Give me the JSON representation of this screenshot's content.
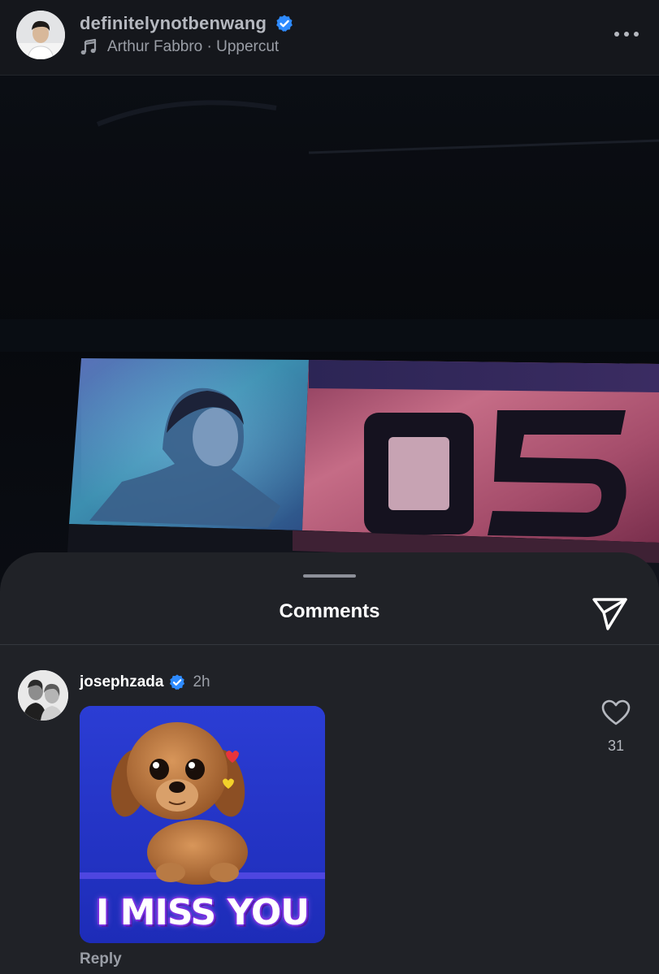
{
  "post": {
    "username": "definitelynotbenwang",
    "verified": true,
    "music_artist": "Arthur Fabbro",
    "music_separator": " · ",
    "music_track": "Uppercut",
    "music_text": "Arthur Fabbro · Uppercut",
    "more_icon": "more-horizontal-icon",
    "media_overlay_text": "05"
  },
  "comments_sheet": {
    "title": "Comments",
    "share_icon": "send-icon",
    "comments": [
      {
        "username": "josephzada",
        "verified": true,
        "time": "2h",
        "gif_caption": "I MISS YOU",
        "reply_label": "Reply",
        "like_count": "31",
        "like_icon": "heart-icon"
      }
    ]
  },
  "colors": {
    "verified_blue": "#2e8bff",
    "sheet_background": "#202227",
    "header_background": "#15171c",
    "gif_background": "#2233c7"
  }
}
